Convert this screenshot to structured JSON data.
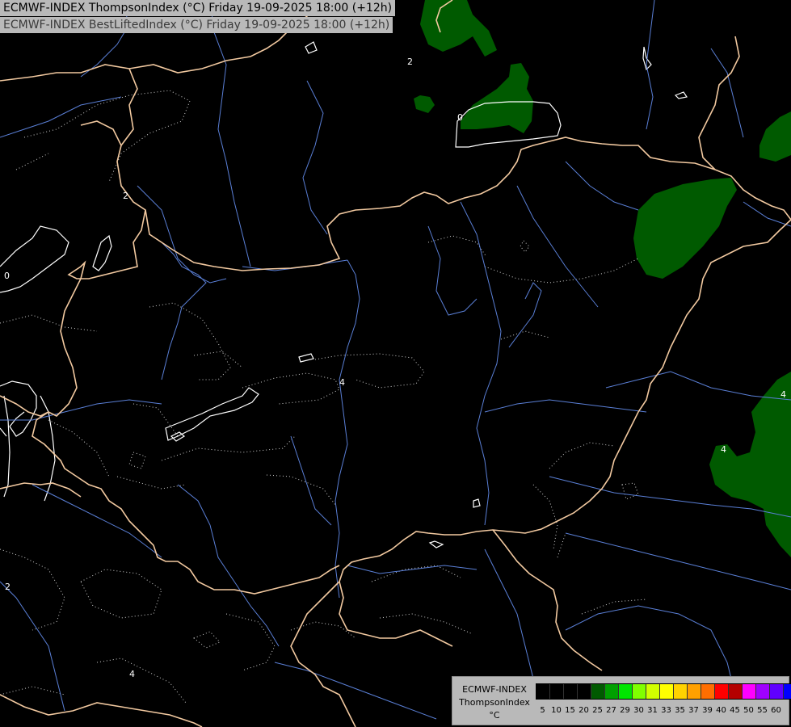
{
  "titles": {
    "line1": "ECMWF-INDEX ThompsonIndex (°C) Friday 19-09-2025 18:00 (+12h)",
    "line2": "ECMWF-INDEX BestLiftedIndex (°C) Friday 19-09-2025 18:00 (+12h)"
  },
  "map": {
    "background": "#000000",
    "border_color": "#f2c9a0",
    "river_color": "#5a7fd6",
    "fill_color": "#005a00",
    "contour_labels": [
      {
        "id": "c1",
        "text": "2"
      },
      {
        "id": "c2",
        "text": "0"
      },
      {
        "id": "c3",
        "text": "0"
      },
      {
        "id": "c4",
        "text": "4"
      },
      {
        "id": "c5",
        "text": "4"
      },
      {
        "id": "c6",
        "text": "2"
      },
      {
        "id": "c7",
        "text": "4"
      },
      {
        "id": "c8",
        "text": "4"
      },
      {
        "id": "c9",
        "text": "2"
      }
    ]
  },
  "legend": {
    "line1": "ECMWF-INDEX",
    "line2": "ThompsonIndex",
    "unit": "°C",
    "ticks": [
      "5",
      "10",
      "15",
      "20",
      "25",
      "27",
      "29",
      "30",
      "31",
      "33",
      "35",
      "37",
      "39",
      "40",
      "45",
      "50",
      "55",
      "60"
    ],
    "colors": [
      "#000000",
      "#000000",
      "#000000",
      "#000000",
      "#005a00",
      "#00a000",
      "#00e600",
      "#80ff00",
      "#d2ff00",
      "#ffff00",
      "#ffd200",
      "#ffa000",
      "#ff6e00",
      "#ff0000",
      "#b40000",
      "#ff00ff",
      "#a000ff",
      "#6000ff",
      "#0000ff"
    ]
  }
}
